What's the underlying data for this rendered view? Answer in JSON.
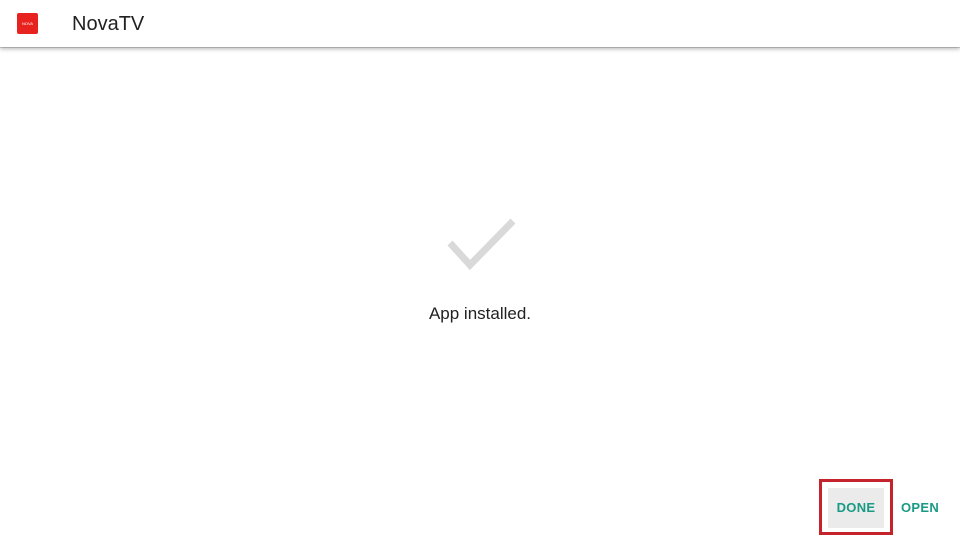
{
  "header": {
    "app_logo_text": "NOVA",
    "app_title": "NovaTV"
  },
  "content": {
    "status_icon": "checkmark-icon",
    "status_text": "App installed."
  },
  "actions": {
    "done_label": "DONE",
    "open_label": "OPEN"
  },
  "colors": {
    "accent": "#189a85",
    "logo_red": "#e8231f",
    "check_gray": "#d9d9d9",
    "highlight_red": "#c4232b"
  }
}
